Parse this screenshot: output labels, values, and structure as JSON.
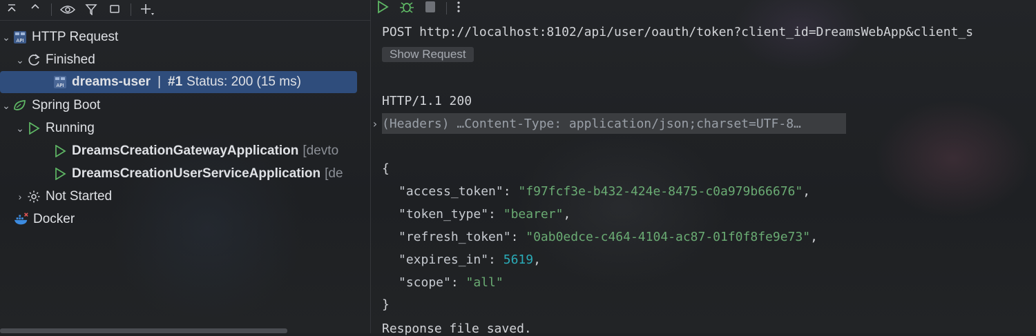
{
  "tree": {
    "http_request": "HTTP Request",
    "finished": "Finished",
    "selected_item": {
      "name": "dreams-user",
      "separator": "|",
      "run": "#1",
      "status": "Status: 200 (15 ms)"
    },
    "spring_boot": "Spring Boot",
    "running": "Running",
    "apps": [
      {
        "name": "DreamsCreationGatewayApplication",
        "suffix": "[devto"
      },
      {
        "name": "DreamsCreationUserServiceApplication",
        "suffix": "[de"
      }
    ],
    "not_started": "Not Started",
    "docker": "Docker"
  },
  "response": {
    "request_line": "POST http://localhost:8102/api/user/oauth/token?client_id=DreamsWebApp&client_s",
    "show_request": "Show Request",
    "status_line": "HTTP/1.1 200",
    "headers_summary": "(Headers) …Content-Type: application/json;charset=UTF-8…",
    "open_brace": "{",
    "close_brace": "}",
    "fields": [
      {
        "key": "\"access_token\"",
        "value": "\"f97fcf3e-b432-424e-8475-c0a979b66676\"",
        "type": "string",
        "trail": ","
      },
      {
        "key": "\"token_type\"",
        "value": "\"bearer\"",
        "type": "string",
        "trail": ","
      },
      {
        "key": "\"refresh_token\"",
        "value": "\"0ab0edce-c464-4104-ac87-01f0f8fe9e73\"",
        "type": "string",
        "trail": ","
      },
      {
        "key": "\"expires_in\"",
        "value": "5619",
        "type": "number",
        "trail": ","
      },
      {
        "key": "\"scope\"",
        "value": "\"all\"",
        "type": "string",
        "trail": ""
      }
    ],
    "saved_note": "Response file saved."
  },
  "colors": {
    "selection": "#2f4d7c",
    "string": "#6aab73",
    "number": "#2aacb8",
    "run_green": "#5fb865",
    "docker_blue": "#3c8be0"
  }
}
